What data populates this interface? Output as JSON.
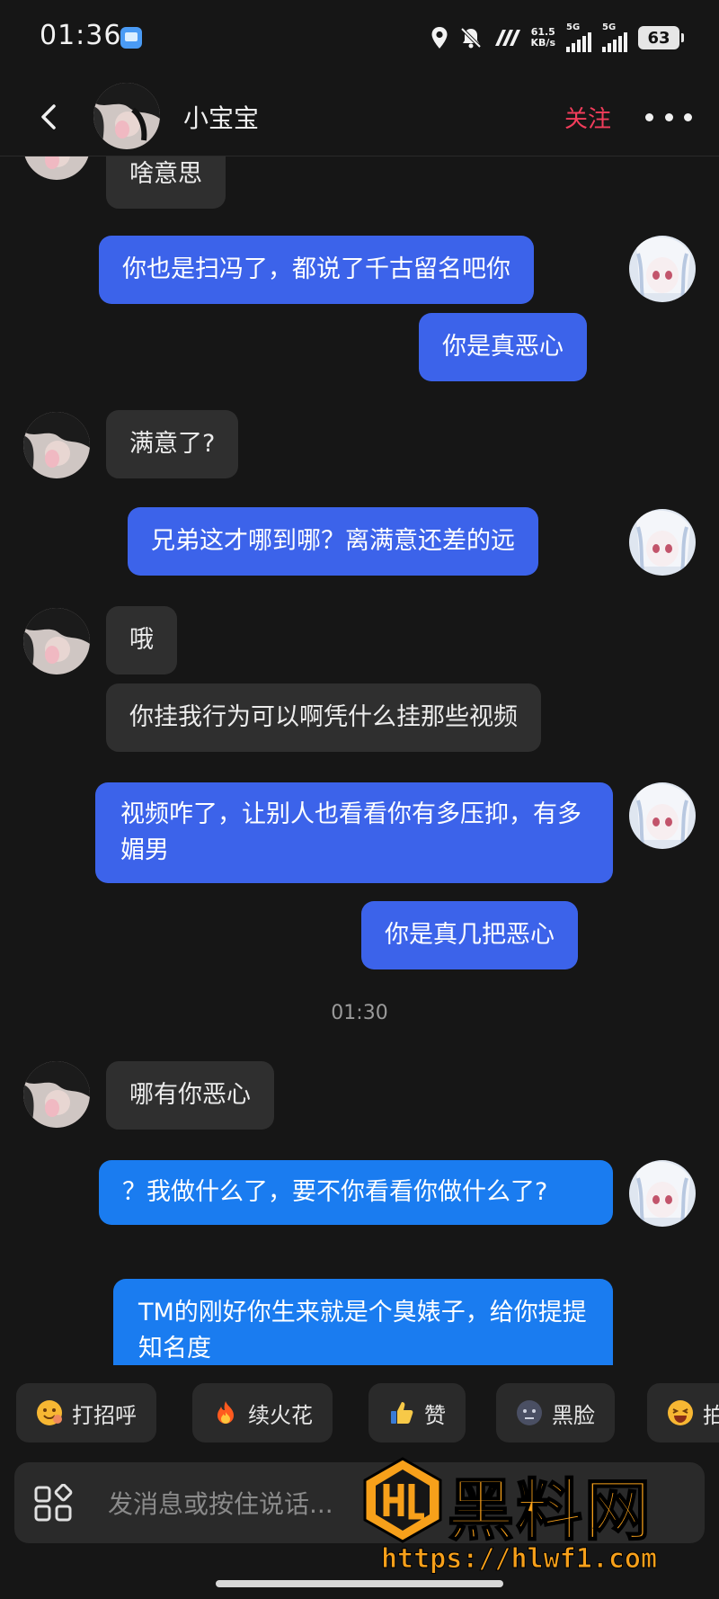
{
  "status_bar": {
    "time": "01:36",
    "net_speed_value": "61.5",
    "net_speed_unit": "KB/s",
    "sim1_label": "5G",
    "sim2_label": "5G",
    "battery": "63"
  },
  "header": {
    "title": "小宝宝",
    "follow_label": "关注"
  },
  "messages": [
    {
      "side": "in",
      "text": "啥意思"
    },
    {
      "side": "out",
      "text": "你也是扫冯了，都说了千古留名吧你"
    },
    {
      "side": "out",
      "text": "你是真恶心"
    },
    {
      "side": "in",
      "text": "满意了?"
    },
    {
      "side": "out",
      "text": "兄弟这才哪到哪？离满意还差的远"
    },
    {
      "side": "in",
      "text": "哦"
    },
    {
      "side": "in",
      "text": "你挂我行为可以啊凭什么挂那些视频"
    },
    {
      "side": "out",
      "text": "视频咋了，让别人也看看你有多压抑，有多媚男"
    },
    {
      "side": "out",
      "text": "你是真几把恶心"
    },
    {
      "side": "timestamp",
      "text": "01:30"
    },
    {
      "side": "in",
      "text": "哪有你恶心"
    },
    {
      "side": "out",
      "text": "？我做什么了，要不你看看你做什么了?"
    },
    {
      "side": "out",
      "text": "TM的刚好你生来就是个臭婊子，给你提提知名度"
    }
  ],
  "quick_replies": [
    {
      "label": "打招呼",
      "icon": "wave-emoji-icon"
    },
    {
      "label": "续火花",
      "icon": "fire-icon"
    },
    {
      "label": "赞",
      "icon": "thumbs-up-icon"
    },
    {
      "label": "黑脸",
      "icon": "dark-face-icon"
    },
    {
      "label": "拍",
      "icon": "laughing-emoji-icon"
    }
  ],
  "composer": {
    "placeholder": "发消息或按住说话..."
  },
  "watermark": {
    "brand": "黑料网",
    "url": "https://hlwf1.com"
  },
  "colors": {
    "background": "#161616",
    "incoming_bubble": "#2f2f2f",
    "outgoing_bubble": "#3c63ea",
    "follow": "#f23d5b",
    "watermark": "#f7a01a"
  }
}
